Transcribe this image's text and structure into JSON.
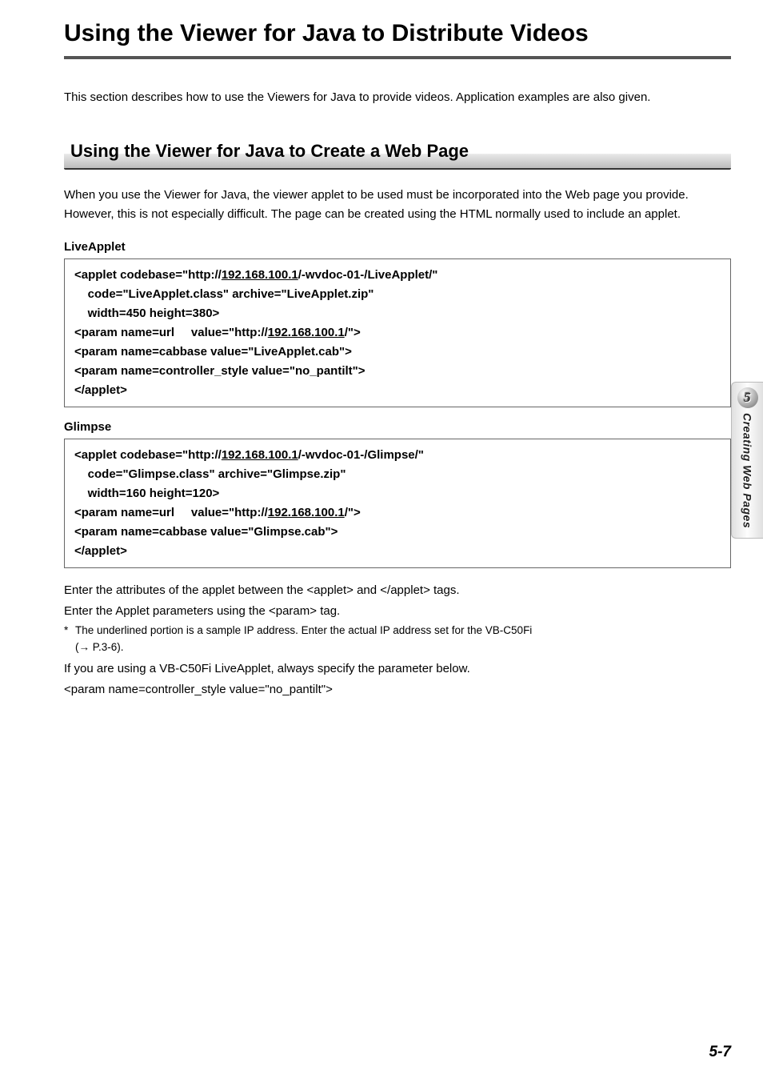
{
  "title": "Using the Viewer for Java to Distribute Videos",
  "intro": "This section describes how to use the Viewers for Java to provide videos. Application examples are also given.",
  "section_heading": "Using the Viewer for Java to Create a Web Page",
  "section_body": "When you use the Viewer for Java, the viewer applet to be used must be incorporated into the Web page you provide. However, this is not especially difficult. The page can be created using the HTML normally used to include an applet.",
  "liveapplet": {
    "label": "LiveApplet",
    "code": {
      "l1_pre": "<applet codebase=\"http://",
      "l1_ip": "192.168.100.1",
      "l1_post": "/-wvdoc-01-/LiveApplet/\"",
      "l2": "    code=\"LiveApplet.class\" archive=\"LiveApplet.zip\"",
      "l3": "    width=450 height=380>",
      "l4_pre": "<param name=url     value=\"http://",
      "l4_ip": "192.168.100.1",
      "l4_post": "/\">",
      "l5": "<param name=cabbase value=\"LiveApplet.cab\">",
      "l6": "<param name=controller_style value=\"no_pantilt\">",
      "l7": "</applet>"
    }
  },
  "glimpse": {
    "label": "Glimpse",
    "code": {
      "l1_pre": "<applet codebase=\"http://",
      "l1_ip": "192.168.100.1",
      "l1_post": "/-wvdoc-01-/Glimpse/\"",
      "l2": "    code=\"Glimpse.class\" archive=\"Glimpse.zip\"",
      "l3": "    width=160 height=120>",
      "l4_pre": "<param name=url     value=\"http://",
      "l4_ip": "192.168.100.1",
      "l4_post": "/\">",
      "l5": "<param name=cabbase value=\"Glimpse.cab\">",
      "l6": "</applet>"
    }
  },
  "notes": {
    "n1": "Enter the attributes of the applet between the <applet> and </applet> tags.",
    "n2": "Enter the Applet parameters using the <param> tag.",
    "n3_ast": "*",
    "n3": "The underlined portion is a sample IP address. Enter the actual IP address set for the VB-C50Fi",
    "n3b_arrow": "→",
    "n3b_pre": "(",
    "n3b_post": " P.3-6).",
    "n4": "If you are using a VB-C50Fi LiveApplet, always specify the parameter below.",
    "n5": "<param name=controller_style value=\"no_pantilt\">"
  },
  "side": {
    "chapter_num": "5",
    "chapter_title": "Creating Web Pages"
  },
  "page_number": "5-7"
}
